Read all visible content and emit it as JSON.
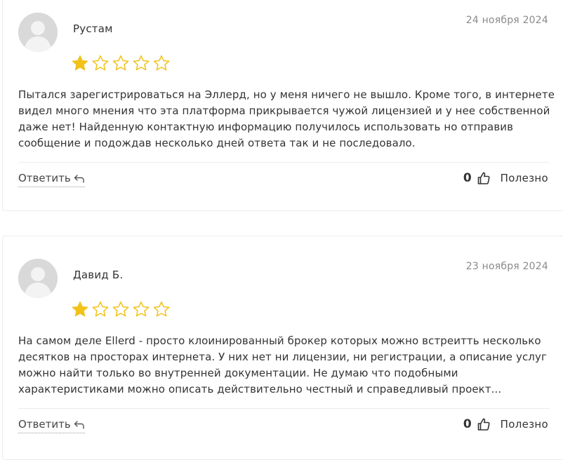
{
  "reviews": [
    {
      "author": "Рустам",
      "date": "24 ноября 2024",
      "rating": 1,
      "max_rating": 5,
      "text": "Пытался зарегистрироваться на Эллерд, но у меня ничего не вышло. Кроме того, в интернете видел много мнения что эта платформа прикрывается чужой лицензией и у нее собственной даже нет! Найденную контактную информацию получилось использовать но отправив сообщение и подождав несколько дней ответа так и не последовало.",
      "reply_label": "Ответить",
      "helpful_count": "0",
      "helpful_label": "Полезно"
    },
    {
      "author": "Давид Б.",
      "date": "23 ноября 2024",
      "rating": 1,
      "max_rating": 5,
      "text": "На самом деле Ellerd - просто клоинированный брокер которых можно встреитть несколько десятков на просторах интернета. У них нет ни лицензии, ни регистрации, а описание услуг можно найти только во внутренней документации. Не думаю что подобными характеристиками можно описать действительно честный и справедливый проект...",
      "reply_label": "Ответить",
      "helpful_count": "0",
      "helpful_label": "Полезно"
    }
  ],
  "icons": {
    "avatar": "user-avatar-icon",
    "star_filled": "star-filled-icon",
    "star_empty": "star-outline-icon",
    "reply": "reply-arrow-icon",
    "helpful": "thumbs-up-icon"
  },
  "colors": {
    "star": "#f2c21a",
    "avatar_bg": "#d9d9d9",
    "avatar_fg": "#f3f3f3",
    "date": "#8a8a8a",
    "border": "#ececec"
  }
}
